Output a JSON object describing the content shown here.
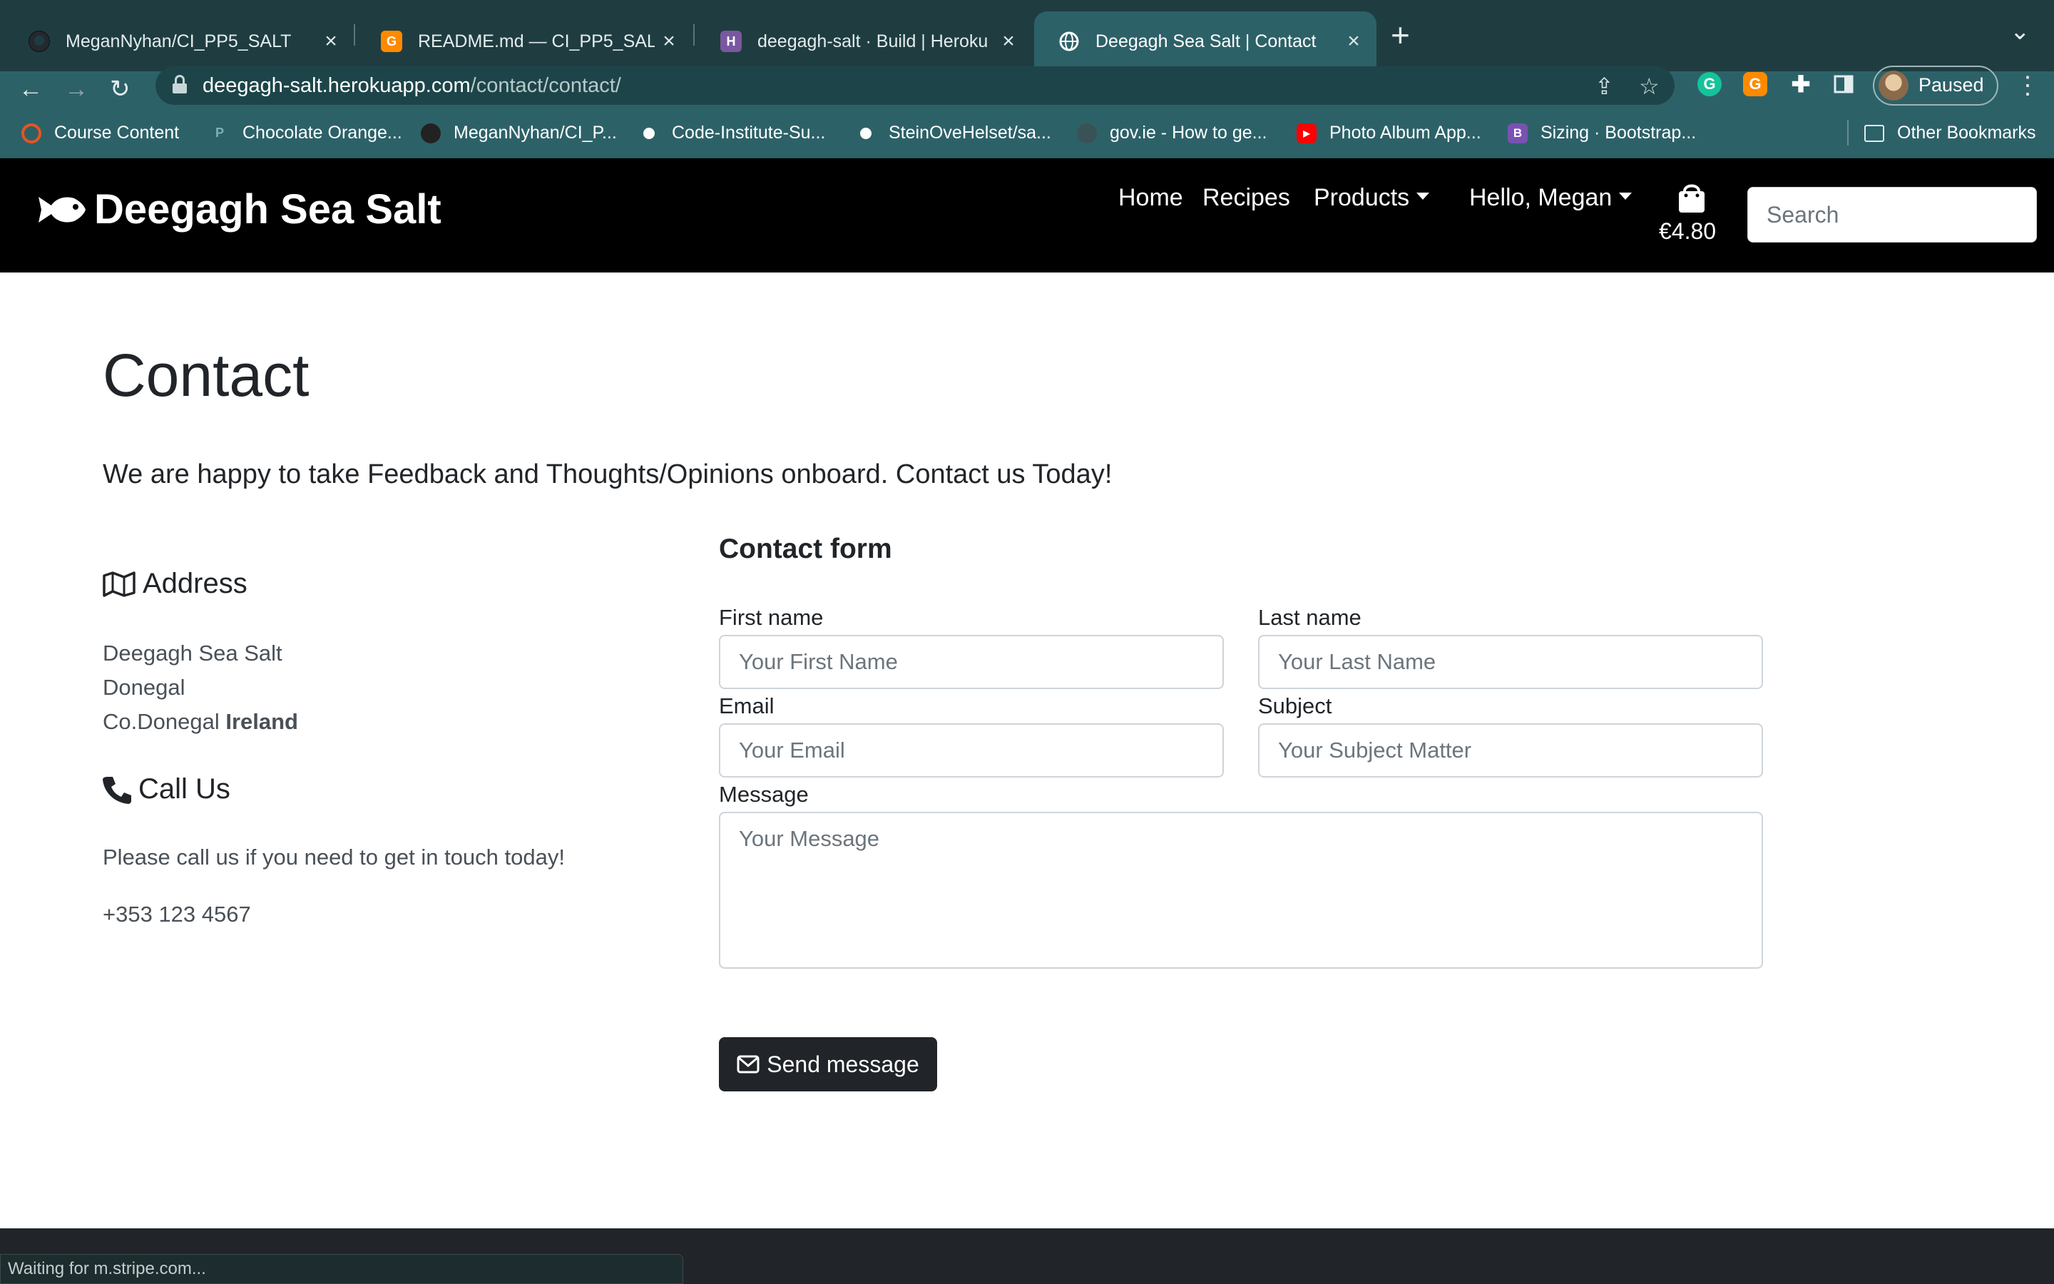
{
  "browser": {
    "tabs": [
      {
        "title": "MeganNyhan/CI_PP5_SALT",
        "icon": "github-icon",
        "active": false
      },
      {
        "title": "README.md — CI_PP5_SALT —",
        "icon": "gitpod-icon",
        "active": false
      },
      {
        "title": "deegagh-salt · Build | Heroku",
        "icon": "heroku-icon",
        "active": false
      },
      {
        "title": "Deegagh Sea Salt | Contact",
        "icon": "globe-icon",
        "active": true
      }
    ],
    "url_host": "deegagh-salt.herokuapp.com",
    "url_path": "/contact/contact/",
    "profile_label": "Paused",
    "bookmarks": [
      {
        "label": "Course Content",
        "icon": "codeinstitute-icon"
      },
      {
        "label": "Chocolate Orange...",
        "icon": "pexels-icon"
      },
      {
        "label": "MeganNyhan/CI_P...",
        "icon": "github-icon"
      },
      {
        "label": "Code-Institute-Su...",
        "icon": "github-icon"
      },
      {
        "label": "SteinOveHelset/sa...",
        "icon": "github-icon"
      },
      {
        "label": "gov.ie - How to ge...",
        "icon": "govie-icon"
      },
      {
        "label": "Photo Album App...",
        "icon": "youtube-icon"
      },
      {
        "label": "Sizing · Bootstrap...",
        "icon": "bootstrap-icon"
      }
    ],
    "other_bookmarks": "Other Bookmarks",
    "status_text": "Waiting for m.stripe.com..."
  },
  "nav": {
    "brand": "Deegagh Sea Salt",
    "home": "Home",
    "recipes": "Recipes",
    "products": "Products",
    "account": "Hello, Megan",
    "bag_total": "€4.80",
    "search_placeholder": "Search"
  },
  "page": {
    "title": "Contact",
    "lead": "We are happy to take Feedback and Thoughts/Opinions onboard. Contact us Today!",
    "address_heading": "Address",
    "address_line1": "Deegagh Sea Salt",
    "address_line2": "Donegal",
    "address_line3": "Co.Donegal",
    "address_country": "Ireland",
    "call_heading": "Call Us",
    "call_text": "Please call us if you need to get in touch today!",
    "phone": "+353 123 4567"
  },
  "form": {
    "title": "Contact form",
    "first_name_label": "First name",
    "first_name_placeholder": "Your First Name",
    "last_name_label": "Last name",
    "last_name_placeholder": "Your Last Name",
    "email_label": "Email",
    "email_placeholder": "Your Email",
    "subject_label": "Subject",
    "subject_placeholder": "Your Subject Matter",
    "message_label": "Message",
    "message_placeholder": "Your Message",
    "send_label": "Send message"
  },
  "colors": {
    "tabstrip": "#1f3d41",
    "toolbar": "#2d6168",
    "navbar": "#000000",
    "button_dark": "#212529"
  }
}
